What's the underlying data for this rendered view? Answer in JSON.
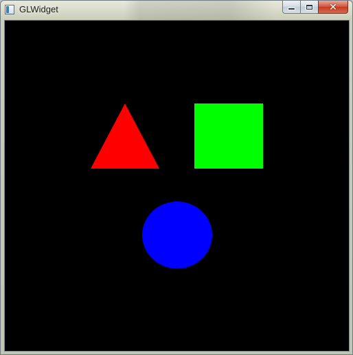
{
  "window": {
    "title": "GLWidget",
    "controls": {
      "minimize_icon": "minimize-icon",
      "maximize_icon": "maximize-icon",
      "close_icon": "close-icon"
    }
  },
  "scene": {
    "background": "#000000",
    "shapes": [
      {
        "kind": "triangle",
        "color": "#ff0000"
      },
      {
        "kind": "square",
        "color": "#00ff00"
      },
      {
        "kind": "circle",
        "color": "#0000ff"
      }
    ]
  }
}
